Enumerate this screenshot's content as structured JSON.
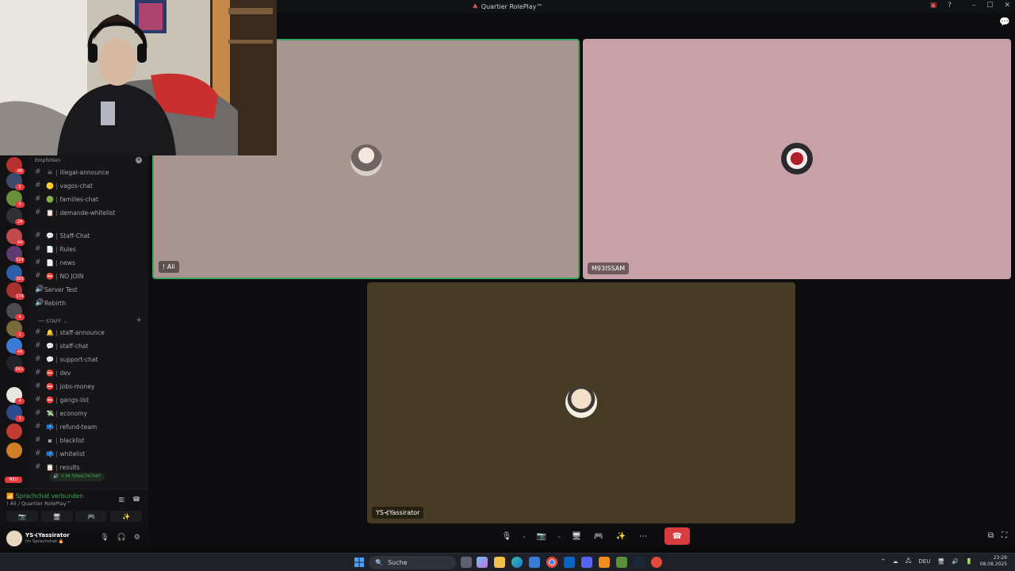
{
  "window": {
    "title": "Quartier RolePlay™",
    "controls": {
      "minimize": "–",
      "maximize": "☐",
      "close": "✕"
    }
  },
  "tiles": [
    {
      "name": "! Ali",
      "bg": "#a8958f",
      "speaking": true
    },
    {
      "name": "M93ISSAM",
      "bg": "#c8a0a7",
      "speaking": false
    },
    {
      "name": "YS⊰Yassirator",
      "bg": "#463b24",
      "speaking": false
    }
  ],
  "sidebar": {
    "recommend_label": "Empfohlen",
    "channels": [
      {
        "emoji": "☠",
        "label": "illegal-announce"
      },
      {
        "emoji": "🟡",
        "label": "vagos-chat"
      },
      {
        "emoji": "🟢",
        "label": "families-chat"
      },
      {
        "emoji": "📋",
        "label": "demande-whitelist"
      },
      {
        "emoji": "💬",
        "label": "Staff-Chat"
      },
      {
        "emoji": "📄",
        "label": "Rules"
      },
      {
        "emoji": "📄",
        "label": "news"
      },
      {
        "emoji": "⛔",
        "label": "NO JOIN"
      },
      {
        "emoji": "",
        "label": "Server Test"
      },
      {
        "emoji": "",
        "label": "Rebirth"
      },
      {
        "emoji": "🔔",
        "label": "staff-announce"
      },
      {
        "emoji": "💬",
        "label": "staff-chat"
      },
      {
        "emoji": "💬",
        "label": "support-chat"
      },
      {
        "emoji": "⛔",
        "label": "dev"
      },
      {
        "emoji": "⛔",
        "label": "jobs-money"
      },
      {
        "emoji": "⛔",
        "label": "gangs-list"
      },
      {
        "emoji": "💸",
        "label": "economy"
      },
      {
        "emoji": "📫",
        "label": "refund-team"
      },
      {
        "emoji": "▪",
        "label": "blacklist"
      },
      {
        "emoji": "📫",
        "label": "whitelist"
      },
      {
        "emoji": "📋",
        "label": "results"
      }
    ],
    "category_staff": "STAFF",
    "in_voice_pill": "3 IM SPRACHCHAT",
    "new_badge": "NEU",
    "guild_badges": [
      "48",
      "5",
      "9",
      "24",
      "44",
      "524",
      "365",
      "174",
      "4",
      "2",
      "44",
      "5K+",
      "4",
      "3"
    ]
  },
  "voice": {
    "status": "Sprachchat verbunden",
    "channel": "! Ali / Quartier RolePlay™"
  },
  "user": {
    "name": "YS⊰Yassirator",
    "status": "Im Sprachchat"
  },
  "taskbar": {
    "search_placeholder": "Suche",
    "lang": "DEU",
    "time": "23:29",
    "date": "08.08.2025"
  },
  "colors": {
    "speaking_ring": "#3ba55c",
    "hangup": "#d83c3e",
    "connected": "#3ba55c"
  }
}
